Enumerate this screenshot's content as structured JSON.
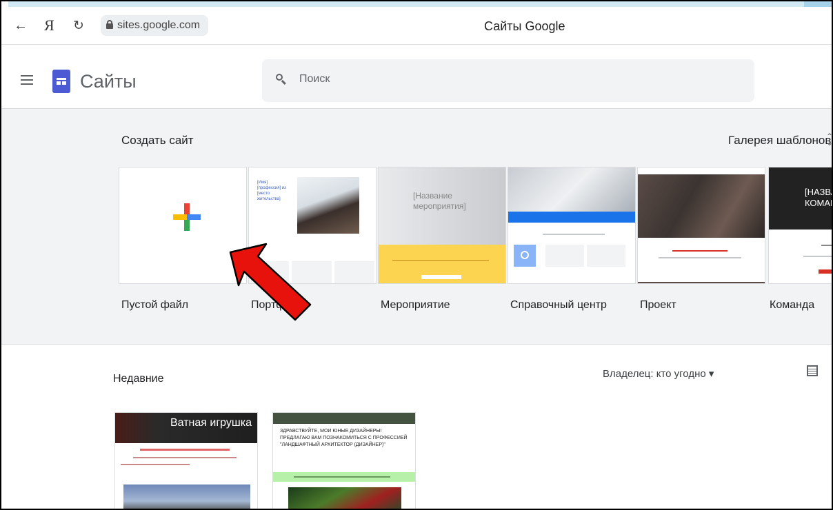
{
  "browser": {
    "back_icon": "arrow-left-icon",
    "yandex_glyph": "Я",
    "reload_icon": "reload-icon",
    "url": "sites.google.com",
    "page_title": "Сайты Google"
  },
  "app": {
    "name": "Сайты",
    "search_placeholder": "Поиск",
    "brand_color": "#4c5bd4"
  },
  "gallery": {
    "title": "Создать сайт",
    "gallery_link": "Галерея шаблонов",
    "templates": [
      {
        "label": "Пустой файл"
      },
      {
        "label": "Портфолио"
      },
      {
        "label": "Мероприятие",
        "preview_title": "[Название мероприятия]"
      },
      {
        "label": "Справочный центр"
      },
      {
        "label": "Проект"
      },
      {
        "label": "Команда",
        "preview_title": "[НАЗВАНИЕ КОМАНДЫ]"
      }
    ],
    "portfolio_preview_text": "[Имя] [профессия] из [место жительства]"
  },
  "annotation": {
    "arrow_color": "#e8120c"
  },
  "recent": {
    "title": "Недавние",
    "owner_filter": "Владелец: кто угодно ▾",
    "sites": [
      {
        "title": "Ватная игрушка"
      },
      {
        "title": "ЗДРАВСТВУЙТЕ, МОИ ЮНЫЕ ДИЗАЙНЕРЫ!",
        "subtitle": "ПРЕДЛАГАЮ ВАМ ПОЗНАКОМИТЬСЯ С ПРОФЕССИЕЙ \"ЛАНДШАФТНЫЙ АРХИТЕКТОР (ДИЗАЙНЕР)\""
      }
    ]
  }
}
